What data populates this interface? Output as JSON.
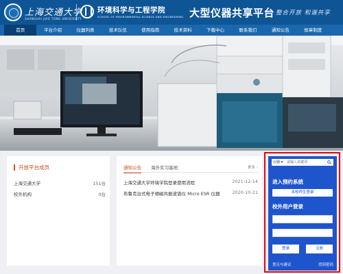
{
  "header": {
    "university_name": "上海交通大学",
    "university_name_en": "SHANGHAI JIAO TONG UNIVERSITY",
    "school_name": "环境科学与工程学院",
    "school_name_en": "SCHOOL OF ENVIRONMENTAL SCIENCE AND ENGINEERING",
    "platform_title": "大型仪器共享平台",
    "slogan": "整合开放  和谐共享"
  },
  "nav": {
    "items": [
      {
        "label": "首页",
        "active": true
      },
      {
        "label": "平台介绍"
      },
      {
        "label": "仪器列表"
      },
      {
        "label": "技术队伍"
      },
      {
        "label": "使用指南"
      },
      {
        "label": "技术资料"
      },
      {
        "label": "下载中心"
      },
      {
        "label": "联系我们"
      },
      {
        "label": "通知公告"
      },
      {
        "label": "规章制度"
      }
    ]
  },
  "members": {
    "title": "开放平台成员",
    "rows": [
      {
        "name": "上海交通大学",
        "count": "151台"
      },
      {
        "name": "校外机构",
        "count": "0台"
      }
    ]
  },
  "news": {
    "tabs": [
      {
        "label": "通知公告",
        "active": true
      },
      {
        "label": "海外实习基地"
      }
    ],
    "more_label": "更多",
    "items": [
      {
        "title": "上海交通大学环境学院登录使用流程",
        "date": "2021-12-14"
      },
      {
        "title": "布鲁克台式电子顺磁共振波谱仪 Micro ESR 仪器",
        "date": "2020-10-21"
      }
    ]
  },
  "login": {
    "search": {
      "select_label": "仪器",
      "placeholder": "请输入关键词"
    },
    "section1_title": "进入预约系统",
    "campus_login_label": "本校师生登录",
    "section2_title": "校外用户登录",
    "login_button": "登录",
    "register_button": "注册",
    "feedback_link": "意见与建议",
    "forgot_link": "找回密码"
  },
  "colors": {
    "header_bg": "#0e5596",
    "nav_bg": "#1a67ad",
    "nav_active": "#0a3f73",
    "accent": "#c8501c",
    "login_bg": "#1f55cc",
    "highlight_outline": "#e60012"
  }
}
